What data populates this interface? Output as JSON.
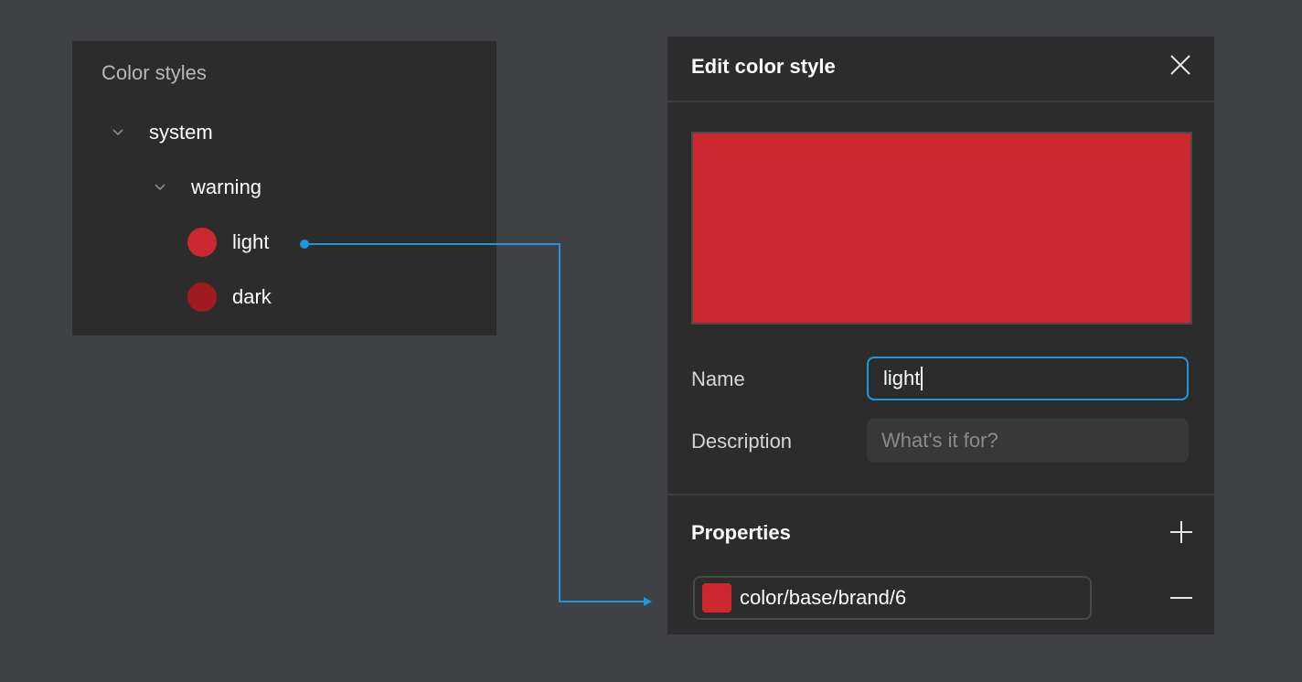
{
  "colors": {
    "background": "#404145",
    "panel": "#2c2c2c",
    "accent": "#1d97e0",
    "light_swatch": "#cc282f",
    "dark_swatch": "#a01a20",
    "brand_swatch": "#cc282f"
  },
  "tree": {
    "title": "Color styles",
    "group": {
      "label": "system",
      "icon": "chevron-down-icon"
    },
    "subgroup": {
      "label": "warning",
      "icon": "chevron-down-icon"
    },
    "items": [
      {
        "label": "light",
        "swatch": "#cc282f"
      },
      {
        "label": "dark",
        "swatch": "#a01a20"
      }
    ]
  },
  "dialog": {
    "title": "Edit color style",
    "close_icon": "close-icon",
    "preview_color": "#cc282f",
    "name_label": "Name",
    "name_value": "light",
    "description_label": "Description",
    "description_placeholder": "What's it for?",
    "properties_title": "Properties",
    "add_icon": "plus-icon",
    "property": {
      "value": "color/base/brand/6",
      "swatch": "#cc282f",
      "remove_icon": "minus-icon"
    }
  }
}
